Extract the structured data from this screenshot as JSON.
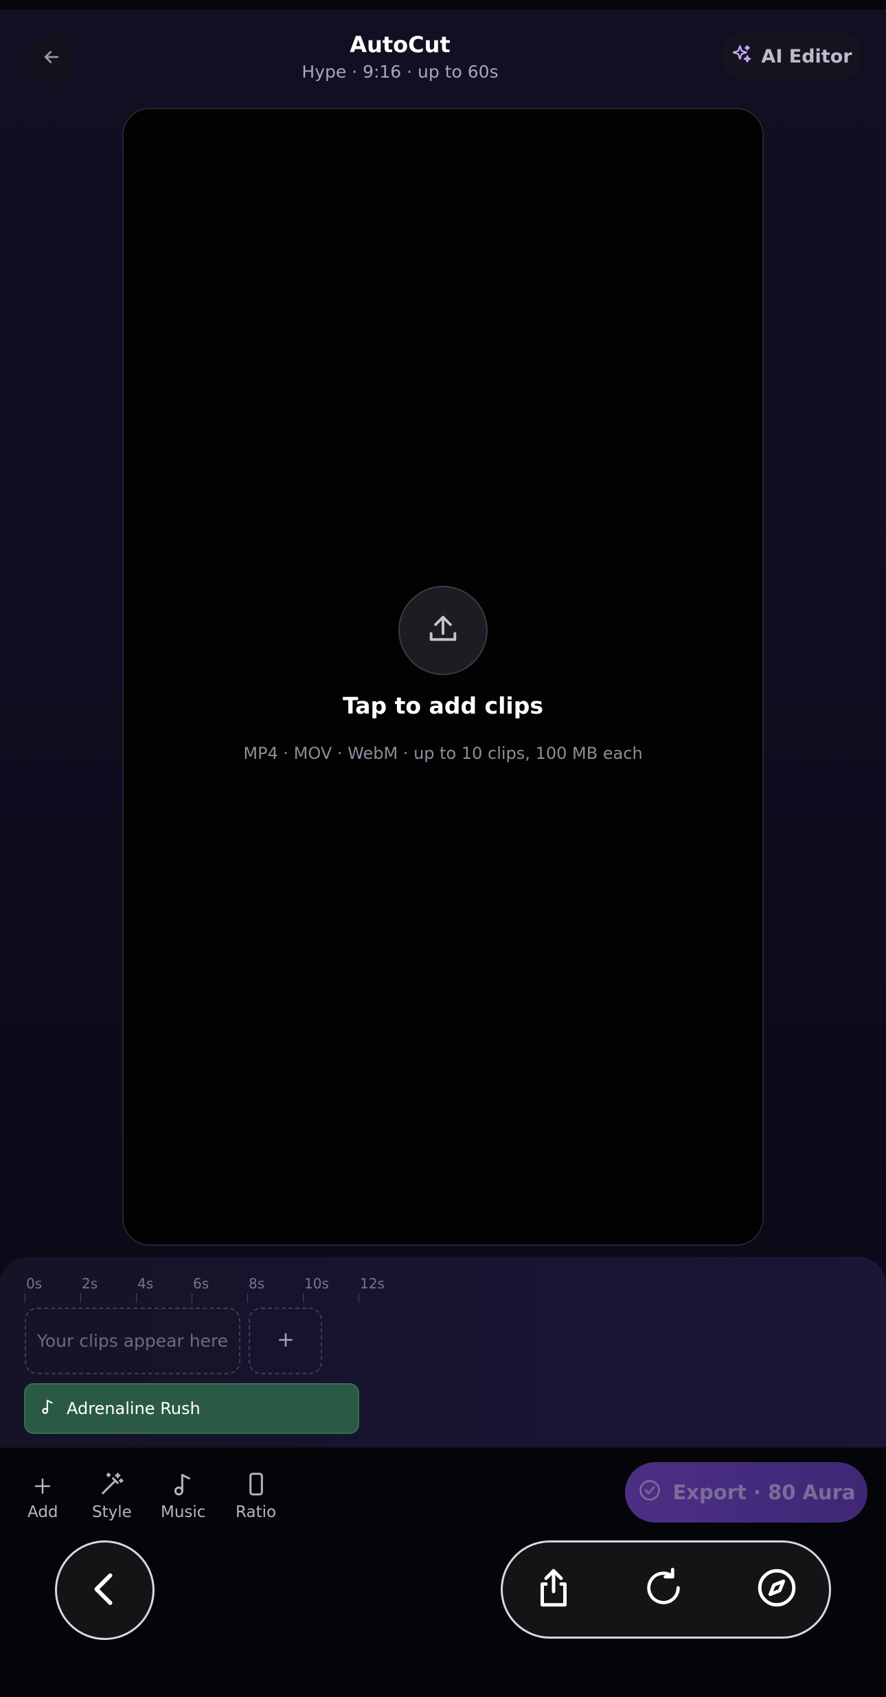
{
  "header": {
    "title": "AutoCut",
    "subtitle": "Hype · 9:16 · up to 60s",
    "ai_editor_label": "AI Editor"
  },
  "preview": {
    "tap_label": "Tap to add clips",
    "formats": "MP4 · MOV · WebM · up to 10 clips, 100 MB each"
  },
  "timeline": {
    "ticks": [
      "0s",
      "2s",
      "4s",
      "6s",
      "8s",
      "10s",
      "12s"
    ],
    "placeholder": "Your clips appear here",
    "music_track": "Adrenaline Rush"
  },
  "toolbar": {
    "add": "Add",
    "style": "Style",
    "music": "Music",
    "ratio": "Ratio",
    "export": "Export · 80 Aura"
  },
  "colors": {
    "accent_purple": "#4b2f84",
    "music_green": "#2a5a45",
    "ai_sparkle": "#c9a7f5"
  },
  "icons": [
    "arrow-left-icon",
    "sparkles-icon",
    "upload-icon",
    "plus-icon",
    "music-note-icon",
    "magic-wand-icon",
    "phone-ratio-icon",
    "check-circle-icon",
    "chevron-left-icon",
    "share-icon",
    "refresh-icon",
    "compass-icon"
  ]
}
